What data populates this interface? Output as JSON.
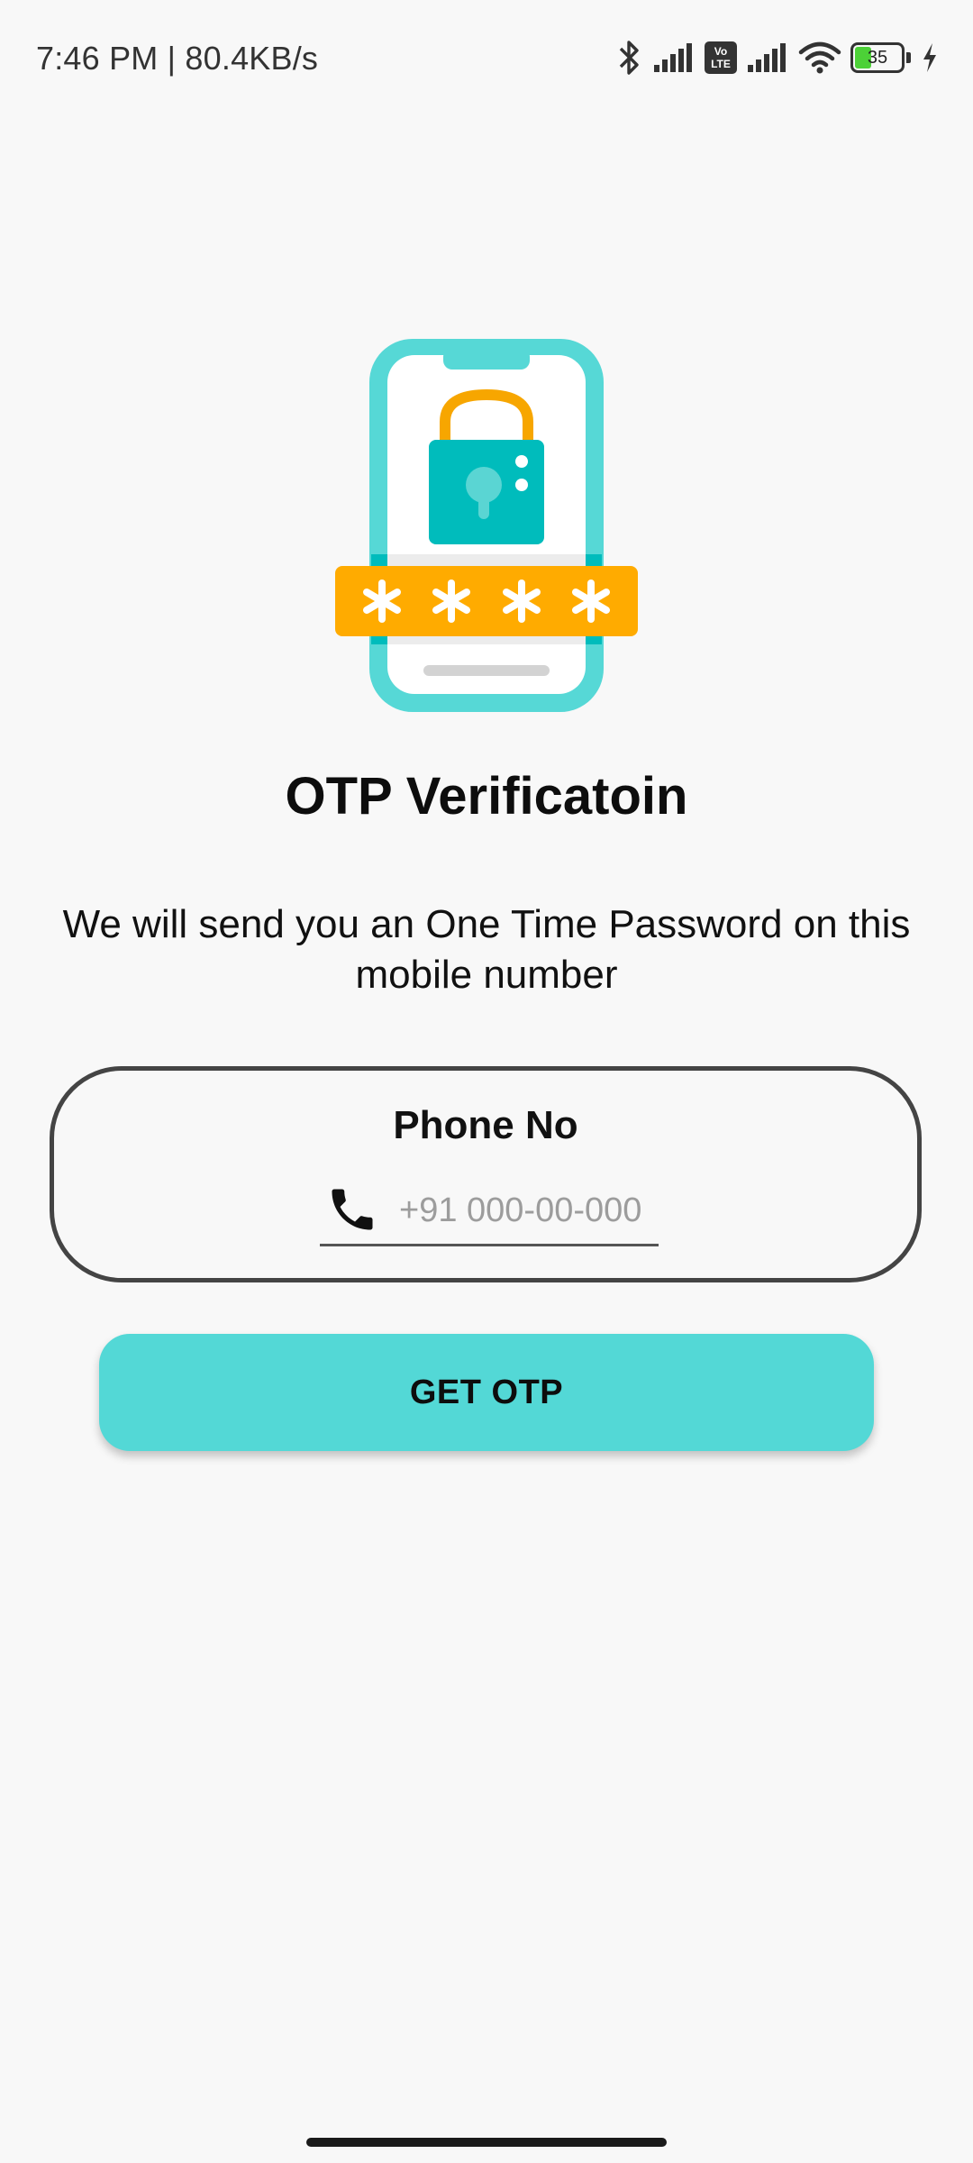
{
  "status_bar": {
    "time_speed": "7:46 PM | 80.4KB/s",
    "volte_badge": "Vo LTE",
    "battery_level": "35",
    "battery_color": "#4cd137",
    "icons": [
      "bluetooth-icon",
      "signal-icon",
      "volte-icon",
      "signal-icon",
      "wifi-icon",
      "battery-icon",
      "charging-icon"
    ]
  },
  "hero": {
    "icon": "phone-lock-password-illustration",
    "colors": {
      "phone_frame": "#56d8d6",
      "lock_body": "#00bcbc",
      "lock_shackle": "#f7a600",
      "password_bar": "#ffab00"
    }
  },
  "title": "OTP Verificatoin",
  "subtitle": "We will send you an One Time Password on this mobile number",
  "phone_card": {
    "label": "Phone No",
    "icon": "phone-icon",
    "input_value": "",
    "input_placeholder": "+91 000-00-000"
  },
  "button": {
    "label": "GET OTP",
    "color": "#53d8d6"
  }
}
